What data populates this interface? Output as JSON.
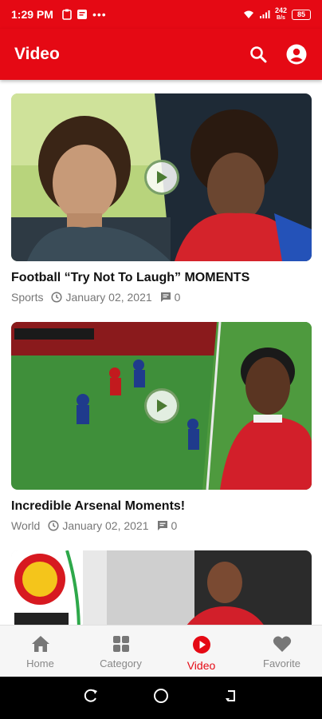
{
  "status_bar": {
    "time": "1:29 PM",
    "dots": "•••",
    "net_speed_top": "242",
    "net_speed_bottom": "B/s",
    "battery_level": "85"
  },
  "app_bar": {
    "title": "Video",
    "icons": [
      "search-icon",
      "account-icon"
    ]
  },
  "videos": [
    {
      "title": "Football “Try Not To Laugh” MOMENTS",
      "category": "Sports",
      "date": "January 02, 2021",
      "comments": "0"
    },
    {
      "title": "Incredible Arsenal Moments!",
      "category": "World",
      "date": "January 02, 2021",
      "comments": "0"
    }
  ],
  "bottom_nav": [
    {
      "label": "Home",
      "icon": "home-icon"
    },
    {
      "label": "Category",
      "icon": "grid-icon"
    },
    {
      "label": "Video",
      "icon": "play-circle-icon",
      "active": true
    },
    {
      "label": "Favorite",
      "icon": "heart-icon"
    }
  ],
  "colors": {
    "accent": "#e50914",
    "nav_inactive": "#888888",
    "meta_text": "#777777"
  }
}
